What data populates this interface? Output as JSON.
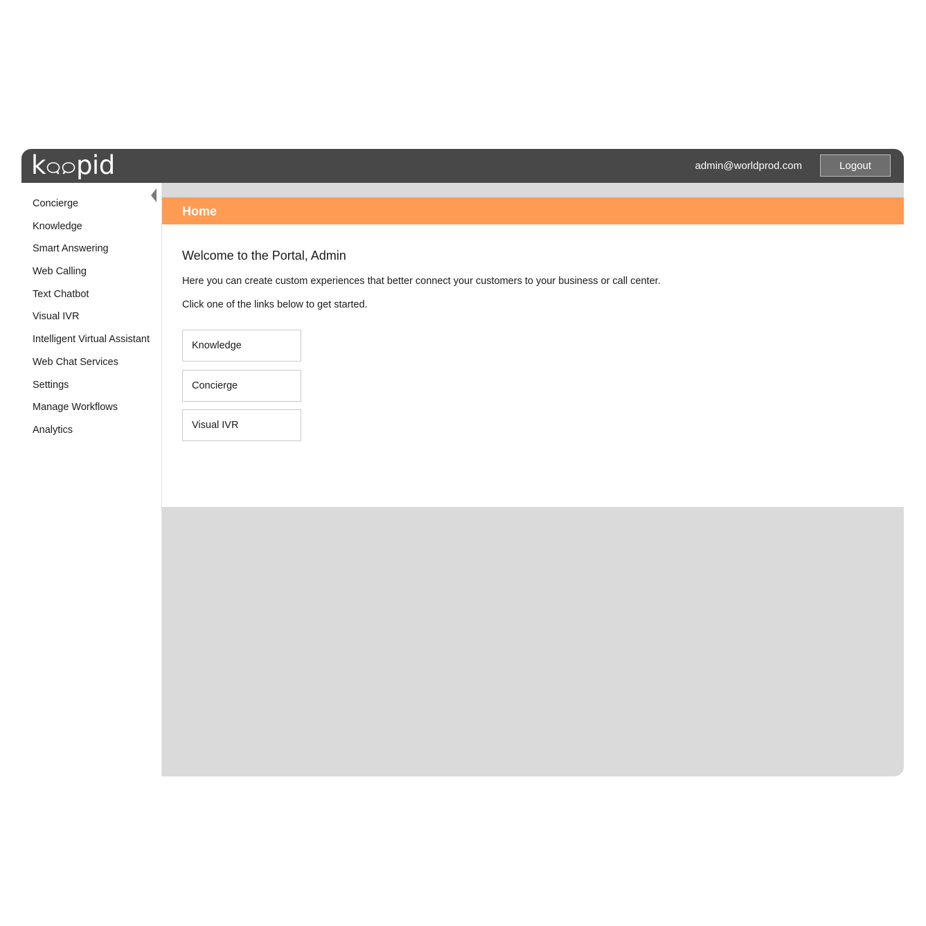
{
  "header": {
    "logo_parts": [
      "k",
      "pid"
    ],
    "user_email": "admin@worldprod.com",
    "logout_label": "Logout"
  },
  "sidebar": {
    "items": [
      {
        "label": "Concierge"
      },
      {
        "label": "Knowledge"
      },
      {
        "label": "Smart Answering"
      },
      {
        "label": "Web Calling"
      },
      {
        "label": "Text Chatbot"
      },
      {
        "label": "Visual IVR"
      },
      {
        "label": "Intelligent Virtual Assistant"
      },
      {
        "label": "Web Chat Services"
      },
      {
        "label": "Settings"
      },
      {
        "label": "Manage Workflows"
      },
      {
        "label": "Analytics"
      }
    ]
  },
  "main": {
    "page_title": "Home",
    "welcome": "Welcome to the Portal, Admin",
    "description": "Here you can create custom experiences that better connect your customers to your business or call center.",
    "instructions": "Click one of the links below to get started.",
    "quick_links": [
      {
        "label": "Knowledge"
      },
      {
        "label": "Concierge"
      },
      {
        "label": "Visual IVR"
      }
    ]
  },
  "colors": {
    "topbar": "#484848",
    "accent": "#ff9b52",
    "content_bg": "#dadada"
  }
}
